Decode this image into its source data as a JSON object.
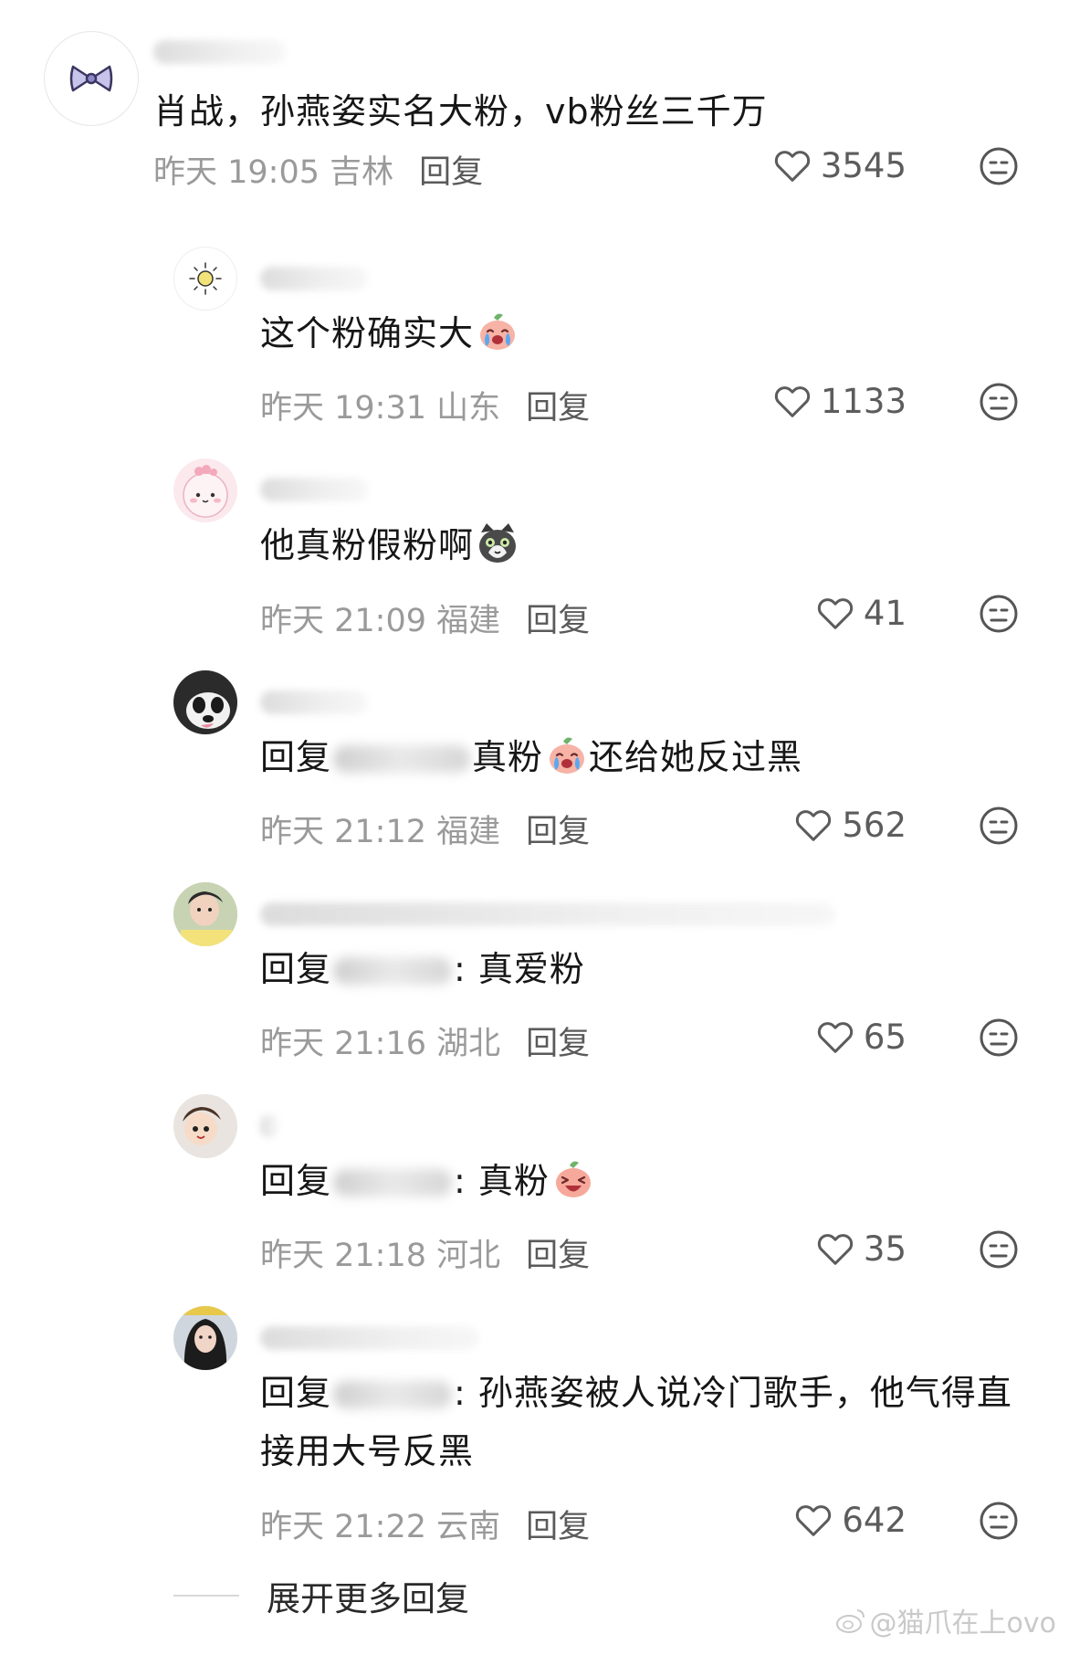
{
  "comments": [
    {
      "text": "肖战，孙燕姿实名大粉，vb粉丝三千万",
      "meta": "昨天 19:05 吉林",
      "reply": "回复",
      "likes": "3545",
      "avatar": "bow-avatar"
    },
    {
      "text": "这个粉确实大",
      "meta": "昨天 19:31 山东",
      "reply": "回复",
      "likes": "1133",
      "avatar": "sun-avatar"
    },
    {
      "text": "他真粉假粉啊",
      "meta": "昨天 21:09 福建",
      "reply": "回复",
      "likes": "41",
      "avatar": "pink-creature-avatar"
    },
    {
      "prefix": "回复",
      "text_after": "真粉",
      "text_end": "还给她反过黑",
      "meta": "昨天 21:12 福建",
      "reply": "回复",
      "likes": "562",
      "avatar": "panda-avatar"
    },
    {
      "prefix": "回复",
      "text_after": ": 真爱粉",
      "meta": "昨天 21:16 湖北",
      "reply": "回复",
      "likes": "65",
      "avatar": "person-avatar"
    },
    {
      "prefix": "回复",
      "text_after": ": 真粉",
      "meta": "昨天 21:18 河北",
      "reply": "回复",
      "likes": "35",
      "avatar": "cartoon-avatar"
    },
    {
      "prefix": "回复",
      "text_after": ": 孙燕姿被人说冷门歌手，他气得直接用大号反黑",
      "meta": "昨天 21:22 云南",
      "reply": "回复",
      "likes": "642",
      "avatar": "girl-avatar"
    }
  ],
  "expand_label": "展开更多回复",
  "watermark": "@猫爪在上ovo",
  "colors": {
    "meta": "#9a9a9a",
    "text": "#161616",
    "icon": "#5c5c5c"
  }
}
